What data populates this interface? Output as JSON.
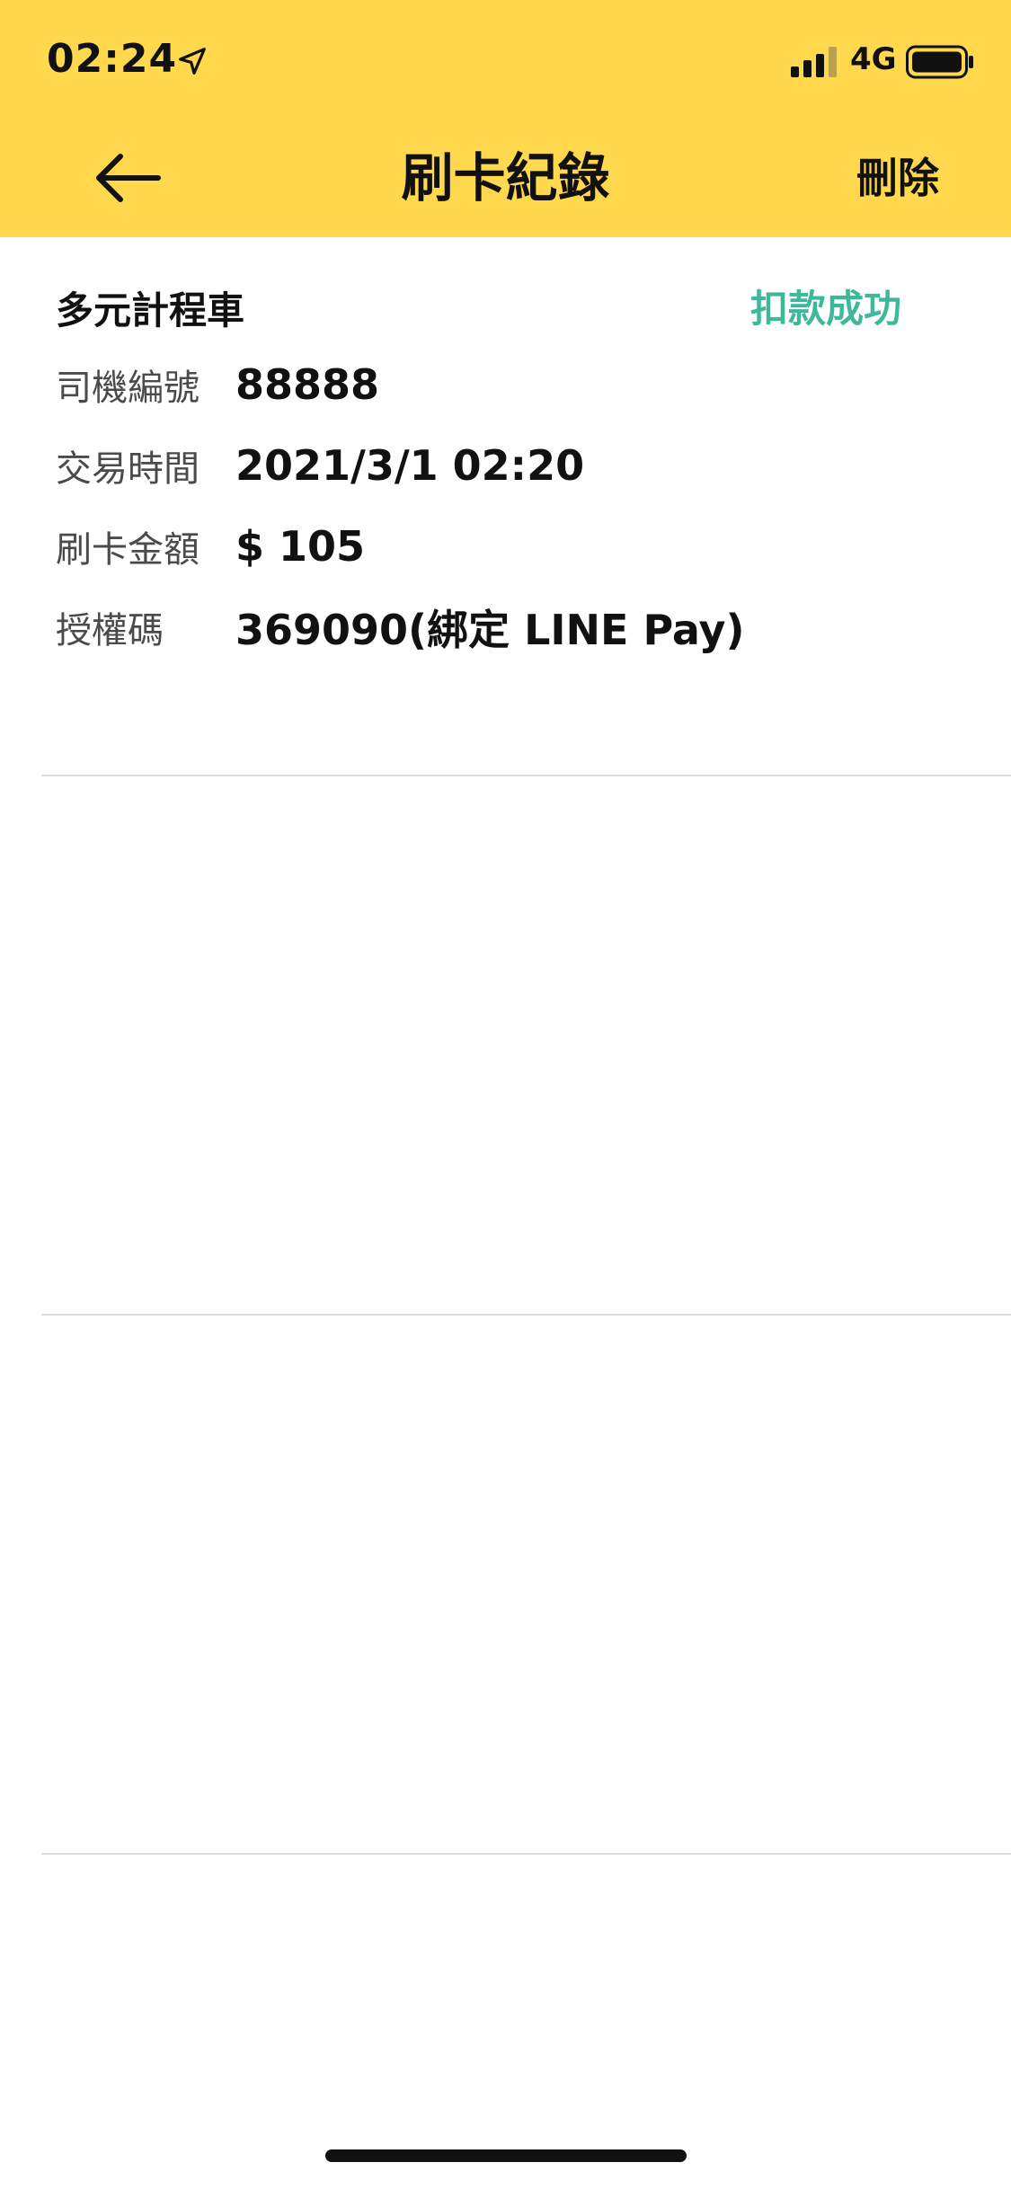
{
  "status_bar": {
    "time": "02:24",
    "network": "4G",
    "location_icon": "location-arrow-icon",
    "signal_icon": "cellular-signal-icon",
    "battery_icon": "battery-icon"
  },
  "nav": {
    "title": "刷卡紀錄",
    "back_icon": "arrow-left-icon",
    "delete_label": "刪除"
  },
  "record": {
    "vendor": "多元計程車",
    "status": "扣款成功",
    "fields": [
      {
        "label": "司機編號",
        "value": "88888"
      },
      {
        "label": "交易時間",
        "value": "2021/3/1 02:20"
      },
      {
        "label": "刷卡金額",
        "value": "$ 105"
      },
      {
        "label": "授權碼",
        "value": "369090(綁定 LINE Pay)"
      }
    ]
  },
  "colors": {
    "header_bg": "#FFD84D",
    "success": "#3DB89A",
    "divider": "#DCDCDC"
  }
}
